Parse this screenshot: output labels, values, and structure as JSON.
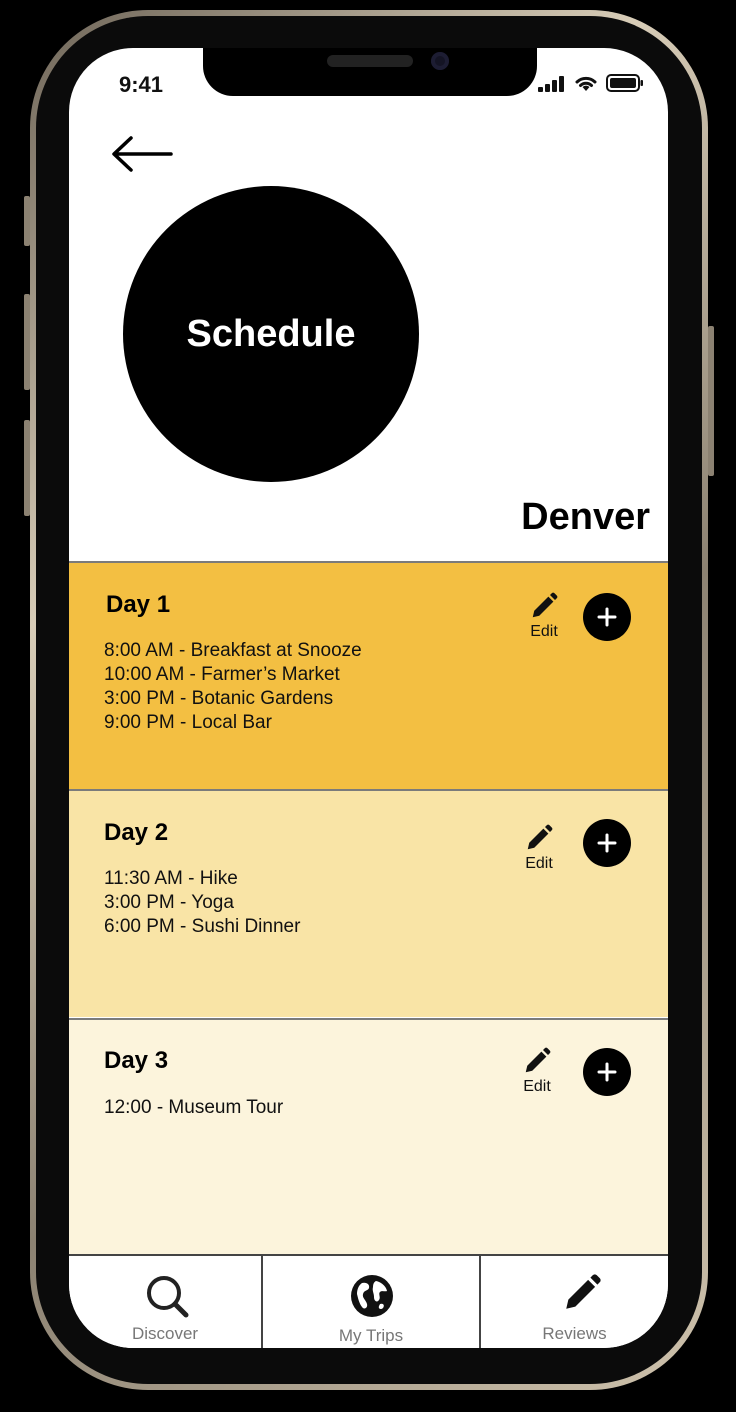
{
  "status_bar": {
    "time": "9:41"
  },
  "header": {
    "title": "Schedule",
    "city": "Denver"
  },
  "days": [
    {
      "title": "Day 1",
      "activities": [
        "8:00 AM - Breakfast at Snooze",
        "10:00 AM - Farmer’s Market",
        "3:00 PM - Botanic Gardens",
        "9:00 PM - Local Bar"
      ],
      "edit_label": "Edit"
    },
    {
      "title": "Day 2",
      "activities": [
        "11:30 AM - Hike",
        "3:00 PM - Yoga",
        "6:00 PM - Sushi Dinner"
      ],
      "edit_label": "Edit"
    },
    {
      "title": "Day 3",
      "activities": [
        "12:00 - Museum Tour"
      ],
      "edit_label": "Edit"
    }
  ],
  "tabs": [
    {
      "label": "Discover",
      "icon": "search-icon"
    },
    {
      "label": "My Trips",
      "icon": "globe-icon"
    },
    {
      "label": "Reviews",
      "icon": "pencil-icon"
    }
  ],
  "colors": {
    "day1": "#f3bf42",
    "day2": "#f9e4a6",
    "day3": "#fcf4dc",
    "accent": "#000000"
  }
}
